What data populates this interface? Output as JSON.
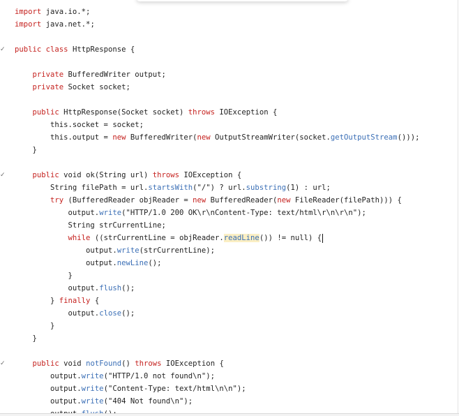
{
  "editor": {
    "lines": [
      {
        "fold": "",
        "tokens": [
          {
            "t": "import",
            "c": "kw"
          },
          {
            "t": " java.io.*;",
            "c": ""
          }
        ]
      },
      {
        "fold": "",
        "tokens": [
          {
            "t": "import",
            "c": "kw"
          },
          {
            "t": " java.net.*;",
            "c": ""
          }
        ]
      },
      {
        "fold": "",
        "tokens": []
      },
      {
        "fold": "✓",
        "tokens": [
          {
            "t": "public",
            "c": "kw"
          },
          {
            "t": " ",
            "c": ""
          },
          {
            "t": "class",
            "c": "kw"
          },
          {
            "t": " HttpResponse {",
            "c": ""
          }
        ]
      },
      {
        "fold": "",
        "tokens": []
      },
      {
        "fold": "",
        "tokens": [
          {
            "t": "    ",
            "c": ""
          },
          {
            "t": "private",
            "c": "kw"
          },
          {
            "t": " BufferedWriter output;",
            "c": ""
          }
        ]
      },
      {
        "fold": "",
        "tokens": [
          {
            "t": "    ",
            "c": ""
          },
          {
            "t": "private",
            "c": "kw"
          },
          {
            "t": " Socket socket;",
            "c": ""
          }
        ]
      },
      {
        "fold": "",
        "tokens": []
      },
      {
        "fold": "",
        "tokens": [
          {
            "t": "    ",
            "c": ""
          },
          {
            "t": "public",
            "c": "kw"
          },
          {
            "t": " HttpResponse(Socket socket) ",
            "c": ""
          },
          {
            "t": "throws",
            "c": "kw"
          },
          {
            "t": " IOException {",
            "c": ""
          }
        ]
      },
      {
        "fold": "",
        "tokens": [
          {
            "t": "        this.socket = socket;",
            "c": ""
          }
        ]
      },
      {
        "fold": "",
        "tokens": [
          {
            "t": "        this.output = ",
            "c": ""
          },
          {
            "t": "new",
            "c": "kw"
          },
          {
            "t": " BufferedWriter(",
            "c": ""
          },
          {
            "t": "new",
            "c": "kw"
          },
          {
            "t": " OutputStreamWriter(socket.",
            "c": ""
          },
          {
            "t": "getOutputStream",
            "c": "fn"
          },
          {
            "t": "()));",
            "c": ""
          }
        ]
      },
      {
        "fold": "",
        "tokens": [
          {
            "t": "    }",
            "c": ""
          }
        ]
      },
      {
        "fold": "",
        "tokens": []
      },
      {
        "fold": "✓",
        "tokens": [
          {
            "t": "    ",
            "c": ""
          },
          {
            "t": "public",
            "c": "kw"
          },
          {
            "t": " void ok(String url) ",
            "c": ""
          },
          {
            "t": "throws",
            "c": "kw"
          },
          {
            "t": " IOException {",
            "c": ""
          }
        ]
      },
      {
        "fold": "",
        "tokens": [
          {
            "t": "        String filePath = url.",
            "c": ""
          },
          {
            "t": "startsWith",
            "c": "fn"
          },
          {
            "t": "(\"/\") ? url.",
            "c": ""
          },
          {
            "t": "substring",
            "c": "fn"
          },
          {
            "t": "(1) : url;",
            "c": ""
          }
        ]
      },
      {
        "fold": "",
        "tokens": [
          {
            "t": "        ",
            "c": ""
          },
          {
            "t": "try",
            "c": "kw"
          },
          {
            "t": " (BufferedReader objReader = ",
            "c": ""
          },
          {
            "t": "new",
            "c": "kw"
          },
          {
            "t": " BufferedReader(",
            "c": ""
          },
          {
            "t": "new",
            "c": "kw"
          },
          {
            "t": " FileReader(filePath))) {",
            "c": ""
          }
        ]
      },
      {
        "fold": "",
        "tokens": [
          {
            "t": "            output.",
            "c": ""
          },
          {
            "t": "write",
            "c": "fn"
          },
          {
            "t": "(\"HTTP/1.0 200 OK\\r\\nContent-Type: text/html\\r\\n\\r\\n\");",
            "c": ""
          }
        ]
      },
      {
        "fold": "",
        "tokens": [
          {
            "t": "            String strCurrentLine;",
            "c": ""
          }
        ]
      },
      {
        "fold": "",
        "tokens": [
          {
            "t": "            ",
            "c": ""
          },
          {
            "t": "while",
            "c": "kw"
          },
          {
            "t": " ((strCurrentLine = objReader.",
            "c": ""
          },
          {
            "t": "readLine",
            "c": "fn hl"
          },
          {
            "t": "()) != null) {",
            "c": ""
          },
          {
            "t": "",
            "c": "cursor"
          }
        ]
      },
      {
        "fold": "",
        "tokens": [
          {
            "t": "                output.",
            "c": ""
          },
          {
            "t": "write",
            "c": "fn"
          },
          {
            "t": "(strCurrentLine);",
            "c": ""
          }
        ]
      },
      {
        "fold": "",
        "tokens": [
          {
            "t": "                output.",
            "c": ""
          },
          {
            "t": "newLine",
            "c": "fn"
          },
          {
            "t": "();",
            "c": ""
          }
        ]
      },
      {
        "fold": "",
        "tokens": [
          {
            "t": "            }",
            "c": ""
          }
        ]
      },
      {
        "fold": "",
        "tokens": [
          {
            "t": "            output.",
            "c": ""
          },
          {
            "t": "flush",
            "c": "fn"
          },
          {
            "t": "();",
            "c": ""
          }
        ]
      },
      {
        "fold": "",
        "tokens": [
          {
            "t": "        } ",
            "c": ""
          },
          {
            "t": "finally",
            "c": "kw"
          },
          {
            "t": " {",
            "c": ""
          }
        ]
      },
      {
        "fold": "",
        "tokens": [
          {
            "t": "            output.",
            "c": ""
          },
          {
            "t": "close",
            "c": "fn"
          },
          {
            "t": "();",
            "c": ""
          }
        ]
      },
      {
        "fold": "",
        "tokens": [
          {
            "t": "        }",
            "c": ""
          }
        ]
      },
      {
        "fold": "",
        "tokens": [
          {
            "t": "    }",
            "c": ""
          }
        ]
      },
      {
        "fold": "",
        "tokens": []
      },
      {
        "fold": "✓",
        "tokens": [
          {
            "t": "    ",
            "c": ""
          },
          {
            "t": "public",
            "c": "kw"
          },
          {
            "t": " void ",
            "c": ""
          },
          {
            "t": "notFound",
            "c": "fn"
          },
          {
            "t": "() ",
            "c": ""
          },
          {
            "t": "throws",
            "c": "kw"
          },
          {
            "t": " IOException {",
            "c": ""
          }
        ]
      },
      {
        "fold": "",
        "tokens": [
          {
            "t": "        output.",
            "c": ""
          },
          {
            "t": "write",
            "c": "fn"
          },
          {
            "t": "(\"HTTP/1.0 not found\\n\");",
            "c": ""
          }
        ]
      },
      {
        "fold": "",
        "tokens": [
          {
            "t": "        output.",
            "c": ""
          },
          {
            "t": "write",
            "c": "fn"
          },
          {
            "t": "(\"Content-Type: text/html\\n\\n\");",
            "c": ""
          }
        ]
      },
      {
        "fold": "",
        "tokens": [
          {
            "t": "        output.",
            "c": ""
          },
          {
            "t": "write",
            "c": "fn"
          },
          {
            "t": "(\"404 Not found\\n\");",
            "c": ""
          }
        ]
      },
      {
        "fold": "",
        "tokens": [
          {
            "t": "        output.",
            "c": ""
          },
          {
            "t": "flush",
            "c": "fn"
          },
          {
            "t": "();",
            "c": ""
          }
        ]
      }
    ]
  },
  "colors": {
    "keyword": "#c5221f",
    "function": "#3b6fb6",
    "text": "#1f1f1f",
    "highlight": "#fbefc4"
  }
}
